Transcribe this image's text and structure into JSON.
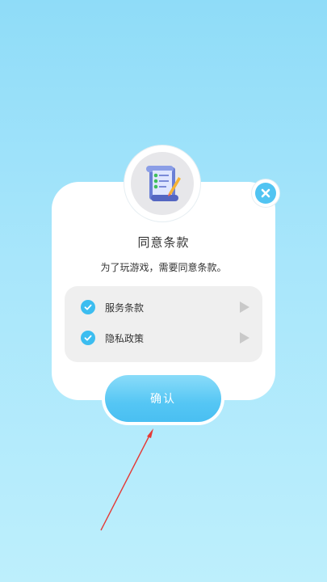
{
  "dialog": {
    "title": "同意条款",
    "subtitle": "为了玩游戏，需要同意条款。",
    "close_icon": "close-icon",
    "badge_icon": "scroll-document-icon",
    "terms": [
      {
        "label": "服务条款",
        "checked": true
      },
      {
        "label": "隐私政策",
        "checked": true
      }
    ],
    "confirm_label": "确认"
  },
  "colors": {
    "accent": "#49bff2",
    "background_top": "#8fdcf8",
    "background_bottom": "#bdeffc",
    "annotation_arrow": "#e53935"
  }
}
